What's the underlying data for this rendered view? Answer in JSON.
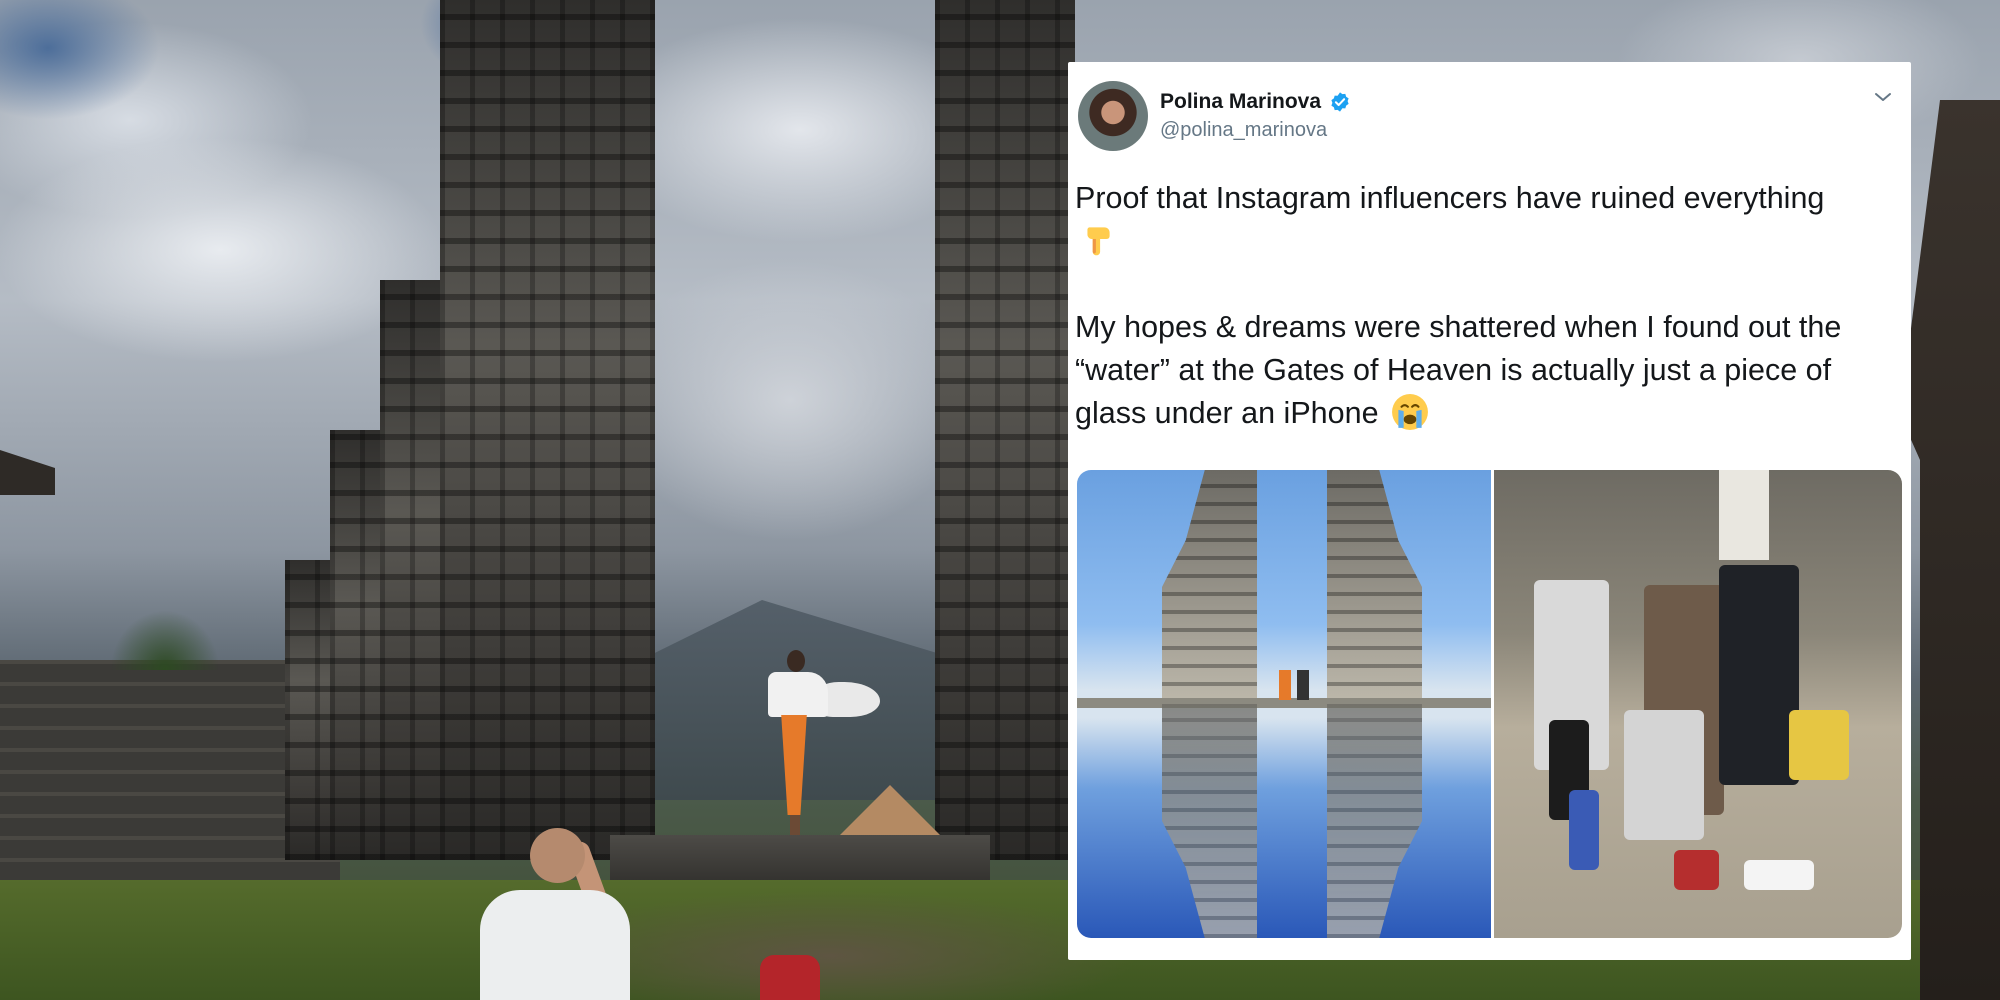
{
  "tweet": {
    "author_name": "Polina Marinova",
    "author_handle": "@polina_marinova",
    "verified": true,
    "text_line1": "Proof that Instagram influencers have ruined everything",
    "emoji1": "backhand-index-pointing-down",
    "text_para2": "My hopes & dreams were shattered when I found out the “water” at the Gates of Heaven is actually just a piece of glass under an iPhone",
    "emoji2": "loudly-crying-face",
    "media": [
      {
        "name": "gates-of-heaven-reflection-photo"
      },
      {
        "name": "people-holding-glass-under-phone-photo"
      }
    ]
  },
  "colors": {
    "card_bg": "#ffffff",
    "name_text": "#14171a",
    "handle_text": "#657786",
    "verified_blue": "#1da1f2"
  }
}
